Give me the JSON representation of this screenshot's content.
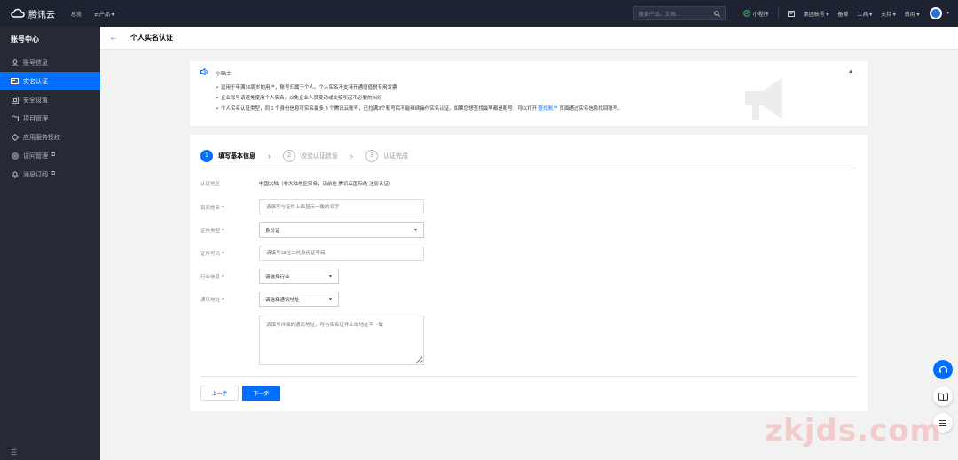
{
  "topbar": {
    "logo_text": "腾讯云",
    "nav": [
      "总览",
      "云产品 ▾"
    ],
    "search_placeholder": "搜索产品、文档...",
    "items": [
      "小程序",
      "集团账号 ▾",
      "备案",
      "工具 ▾",
      "支持 ▾",
      "费用 ▾"
    ]
  },
  "sidebar": {
    "title": "账号中心",
    "items": [
      {
        "label": "账号信息",
        "icon": "user-icon",
        "active": false
      },
      {
        "label": "实名认证",
        "icon": "id-card-icon",
        "active": true
      },
      {
        "label": "安全设置",
        "icon": "shield-icon",
        "active": false
      },
      {
        "label": "项目管理",
        "icon": "folder-icon",
        "active": false
      },
      {
        "label": "应用服务授权",
        "icon": "diamond-icon",
        "active": false
      },
      {
        "label": "访问管理",
        "icon": "lock-icon",
        "active": false,
        "external": true
      },
      {
        "label": "消息订阅",
        "icon": "bell-icon",
        "active": false,
        "external": true
      }
    ]
  },
  "page": {
    "title": "个人实名认证"
  },
  "tips": {
    "title": "小贴士",
    "lines": [
      "适用于年满16周岁的用户，账号归属于个人。个人实名不支持开通增值税专用发票",
      "企业账号请避免使用个人实名，以免企业人员变动或交接引起不必要的纠纷"
    ],
    "line3_pre": "个人实名认证类型，同 1 个身份信息可实名最多 3 个腾讯云账号，已拉满3个账号后不能继续操作实名认证。如果您想查找最早都是账号，可以打开",
    "line3_link": "查找账户",
    "line3_post": "页面通过实名信息找回账号。"
  },
  "steps": [
    {
      "num": "1",
      "label": "填写基本信息",
      "active": true
    },
    {
      "num": "2",
      "label": "校验认证信息",
      "active": false
    },
    {
      "num": "3",
      "label": "认证完成",
      "active": false
    }
  ],
  "form": {
    "region_label": "认证地区",
    "region_value": "中国大陆（非大陆地区实名，请前往 腾讯云国际站 注册认证）",
    "name_label": "真实姓名",
    "name_placeholder": "请填写与证件上面显示一致的名字",
    "idtype_label": "证件类型",
    "idtype_value": "身份证",
    "idnum_label": "证件号码",
    "idnum_placeholder": "请填写18位二代身份证号码",
    "industry_label": "行业信息",
    "industry_value": "请选择行业",
    "address_label": "通讯地址",
    "address_value": "请选择通讯地址",
    "address_detail_placeholder": "请填写详细的通讯地址，可与实名证件上的地址不一致"
  },
  "buttons": {
    "prev": "上一步",
    "next": "下一步"
  },
  "watermark": "zkjds.com",
  "colors": {
    "accent": "#006eff",
    "topbar": "#1d2330",
    "sidebar": "#252a35",
    "required": "#e54545"
  }
}
